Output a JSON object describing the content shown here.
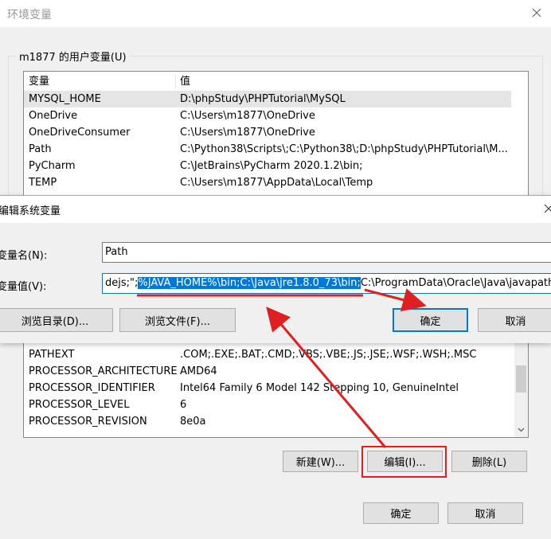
{
  "outer_dialog": {
    "title": "环境变量",
    "user_group_label": "m1877 的用户变量(U)",
    "col_var": "变量",
    "col_val": "值",
    "user_rows": [
      {
        "name": "MYSQL_HOME",
        "value": "D:\\phpStudy\\PHPTutorial\\MySQL"
      },
      {
        "name": "OneDrive",
        "value": "C:\\Users\\m1877\\OneDrive"
      },
      {
        "name": "OneDriveConsumer",
        "value": "C:\\Users\\m1877\\OneDrive"
      },
      {
        "name": "Path",
        "value": "C:\\Python38\\Scripts\\;C:\\Python38\\;D:\\phpStudy\\PHPTutorial\\M..."
      },
      {
        "name": "PyCharm",
        "value": "C:\\JetBrains\\PyCharm 2020.1.2\\bin;"
      },
      {
        "name": "TEMP",
        "value": "C:\\Users\\m1877\\AppData\\Local\\Temp"
      }
    ],
    "system_rows": [
      {
        "name": "PATHEXT",
        "value": ".COM;.EXE;.BAT;.CMD;.VBS;.VBE;.JS;.JSE;.WSF;.WSH;.MSC"
      },
      {
        "name": "PROCESSOR_ARCHITECTURE",
        "value": "AMD64"
      },
      {
        "name": "PROCESSOR_IDENTIFIER",
        "value": "Intel64 Family 6 Model 142 Stepping 10, GenuineIntel"
      },
      {
        "name": "PROCESSOR_LEVEL",
        "value": "6"
      },
      {
        "name": "PROCESSOR_REVISION",
        "value": "8e0a"
      }
    ],
    "btn_new": "新建(W)...",
    "btn_edit": "编辑(I)...",
    "btn_delete": "删除(L)",
    "btn_ok": "确定",
    "btn_cancel": "取消"
  },
  "edit_dialog": {
    "title": "编辑系统变量",
    "name_label": "变量名(N):",
    "name_value": "Path",
    "value_label": "变量值(V):",
    "value_prefix": "dejs;\";",
    "value_selected": "%JAVA_HOME%\\bin;C:\\Java\\jre1.8.0_73\\bin;",
    "value_suffix": "C:\\ProgramData\\Oracle\\Java\\javapath;C",
    "btn_browse_dir": "浏览目录(D)...",
    "btn_browse_file": "浏览文件(F)...",
    "btn_ok": "确定",
    "btn_cancel": "取消"
  },
  "icons": {
    "close": "close-icon",
    "scroll_down": "chevron-down-icon"
  },
  "colors": {
    "selection": "#0078d7",
    "annotation": "#e02020",
    "primary_border": "#0078d7"
  }
}
